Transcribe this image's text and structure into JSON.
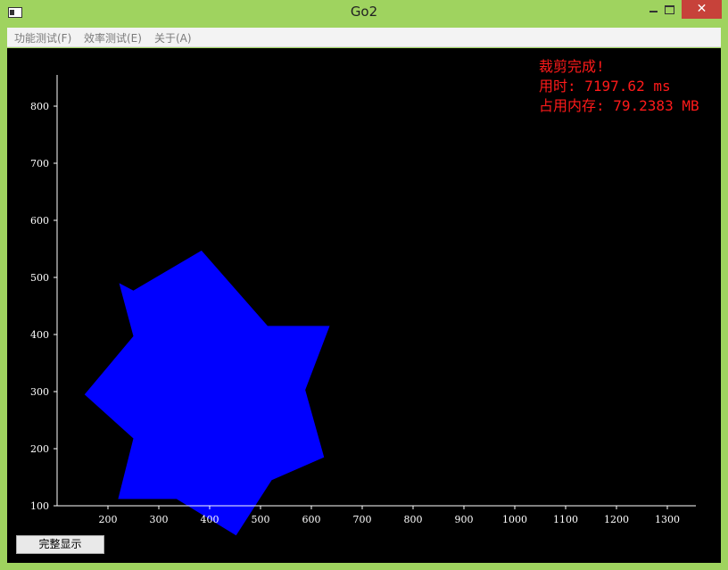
{
  "window": {
    "title": "Go2"
  },
  "menu": [
    "功能测试(F)",
    "效率测试(E)",
    "关于(A)"
  ],
  "status": {
    "line1": "裁剪完成!",
    "line2": "用时: 7197.62 ms",
    "line3": "占用内存: 79.2383 MB"
  },
  "button": {
    "show_all": "完整显示"
  },
  "colors": {
    "shape": "#0000ff",
    "status_text": "#ff1a1a",
    "close_button": "#c7423a",
    "frame": "#9fd35f"
  },
  "chart_data": {
    "type": "polygon",
    "title": "",
    "xlabel": "",
    "ylabel": "",
    "xlim": [
      100,
      1350
    ],
    "ylim": [
      100,
      850
    ],
    "xticks": [
      200,
      300,
      400,
      500,
      600,
      700,
      800,
      900,
      1000,
      1100,
      1200,
      1300
    ],
    "yticks": [
      100,
      200,
      300,
      400,
      500,
      600,
      700,
      800
    ],
    "polygon": [
      [
        222,
        490
      ],
      [
        250,
        477
      ],
      [
        384,
        547
      ],
      [
        514,
        415
      ],
      [
        636,
        415
      ],
      [
        588,
        303
      ],
      [
        625,
        185
      ],
      [
        522,
        145
      ],
      [
        452,
        48
      ],
      [
        335,
        112
      ],
      [
        220,
        112
      ],
      [
        250,
        218
      ],
      [
        154,
        295
      ],
      [
        250,
        397
      ]
    ],
    "fill": "#0000ff"
  }
}
